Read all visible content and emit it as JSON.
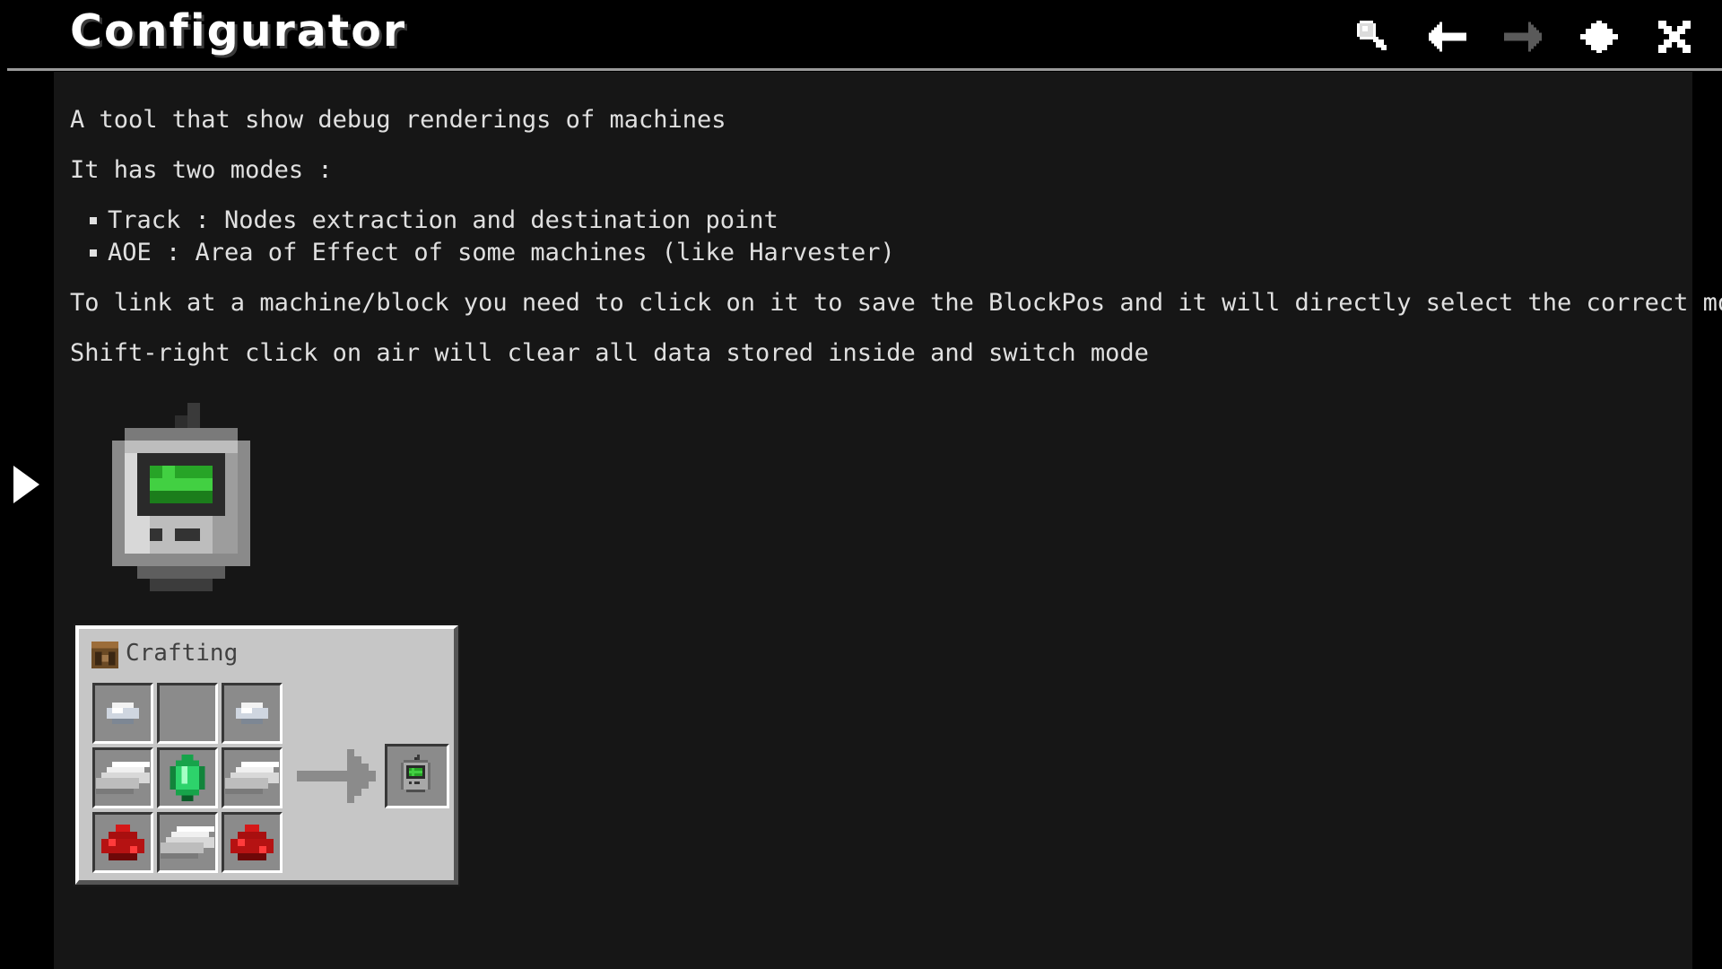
{
  "header": {
    "title": "Configurator",
    "tools": [
      "search-icon",
      "arrow-left-icon",
      "arrow-right-icon",
      "bookmark-icon",
      "close-icon"
    ]
  },
  "content": {
    "paragraphs": [
      "A tool that show debug renderings of machines",
      "It has two modes :"
    ],
    "modes": [
      "Track : Nodes extraction and destination point",
      "AOE : Area of Effect of some machines (like Harvester)"
    ],
    "notes": [
      "To link at a machine/block you need to click on it to save the BlockPos and it will directly select the correct mode",
      "Shift-right click on air will clear all data stored inside and switch mode"
    ]
  },
  "illustration": {
    "item": "configurator-icon"
  },
  "recipe": {
    "title": "Crafting",
    "grid": [
      [
        "iron-nugget-icon",
        "",
        "iron-nugget-icon"
      ],
      [
        "iron-ingot-icon",
        "emerald-icon",
        "iron-ingot-icon"
      ],
      [
        "redstone-icon",
        "iron-ingot-icon",
        "redstone-icon"
      ]
    ],
    "output": "configurator-icon"
  },
  "colors": {
    "background": "#161616",
    "text": "#e0e0e0",
    "panel": "#c6c6c6",
    "slot": "#8b8b8b"
  }
}
